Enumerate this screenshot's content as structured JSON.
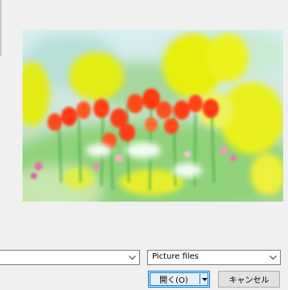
{
  "dialog": {
    "filename_value": "",
    "file_type": {
      "selected": "Picture files"
    },
    "buttons": {
      "open_label": "開く(O)",
      "cancel_label": "キャンセル"
    }
  },
  "preview": {
    "subject": "tulip-field-photo",
    "colors": {
      "sky": "#cfe8f0",
      "tulip": "#ff4a1c",
      "blur_yellow": "#e8ef10",
      "foliage": "#7ec86a"
    }
  },
  "icons": {
    "dropdown": "chevron-down-icon",
    "split_arrow": "triangle-down-icon"
  }
}
